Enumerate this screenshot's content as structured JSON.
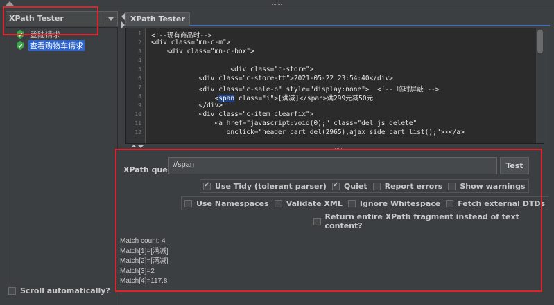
{
  "left_panel": {
    "combo_label": "XPath Tester",
    "tree_items": [
      {
        "label": "登陆请求",
        "selected": false,
        "icon": "shield-check-icon"
      },
      {
        "label": "查看购物车请求",
        "selected": true,
        "icon": "shield-check-icon"
      }
    ],
    "scroll_auto_label": "Scroll automatically?"
  },
  "tab": {
    "label": "XPath Tester"
  },
  "editor": {
    "line_numbers": [
      "1",
      "2",
      "3",
      "4",
      "5",
      "6",
      "7",
      "8",
      "9",
      "10",
      "11",
      "12"
    ],
    "lines": [
      "<!--现有商品时-->",
      "<div class=\"mn-c-m\">",
      "    <div class=\"mn-c-box\">",
      "",
      "                    <div class=\"c-store\">",
      "            <div class=\"c-store-tt\">2021-05-22 23:54:40</div>",
      "            <div class=\"c-sale-b\" style=\"display:none\">  <!-- 临时屏蔽 -->",
      "                <",
      "            </div>",
      "            <div class=\"c-item clearfix\">",
      "                <a href=\"javascript:void(0);\" class=\"del js_delete\"",
      "                   onclick=\"header_cart_del(2965),ajax_side_cart_list();\">×</a>"
    ],
    "line8_tag": "span",
    "line8_rest": " class=\"i\">[满减]</span>满299元减50元"
  },
  "query": {
    "label": "XPath query :",
    "value": "//span",
    "test_button": "Test"
  },
  "options_row1": [
    {
      "label": "Use Tidy (tolerant parser)",
      "checked": true
    },
    {
      "label": "Quiet",
      "checked": true
    },
    {
      "label": "Report errors",
      "checked": false
    },
    {
      "label": "Show warnings",
      "checked": false
    }
  ],
  "options_row2": [
    {
      "label": "Use Namespaces",
      "checked": false
    },
    {
      "label": "Validate XML",
      "checked": false
    },
    {
      "label": "Ignore Whitespace",
      "checked": false
    },
    {
      "label": "Fetch external DTDs",
      "checked": false
    }
  ],
  "options_row3": [
    {
      "label": "Return entire XPath fragment instead of text content?",
      "checked": false
    }
  ],
  "results": [
    "Match count: 4",
    "Match[1]=[满减]",
    "Match[2]=[满减]",
    "Match[3]=2",
    "Match[4]=117.8"
  ]
}
